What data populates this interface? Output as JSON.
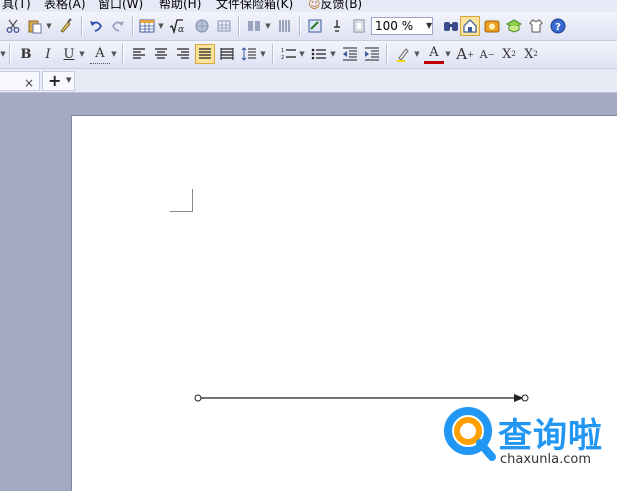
{
  "menubar": {
    "items": [
      "具(T)",
      "表格(A)",
      "窗口(W)",
      "帮助(H)",
      "文件保险箱(K)",
      "反馈(B)"
    ]
  },
  "toolbar_standard": {
    "zoom_value": "100 %",
    "icons": [
      "cut-icon",
      "paste-icon",
      "format-painter-icon",
      "undo-icon",
      "redo-icon",
      "insert-table-icon",
      "formula-icon",
      "hyperlink-icon",
      "table-grid-icon",
      "columns-icon",
      "text-direction-icon",
      "drawing-icon",
      "text-box-icon",
      "page-icon",
      "find-icon",
      "home-icon",
      "gallery-icon",
      "template-icon",
      "skin-icon",
      "help-icon"
    ]
  },
  "toolbar_format": {
    "bold_label": "B",
    "italic_label": "I",
    "underline_label": "U",
    "char_border_label": "A",
    "font_color_label": "A",
    "grow_font_label": "A",
    "shrink_font_label": "A",
    "superscript_label": "X",
    "superscript_mark": "2",
    "subscript_label": "X",
    "subscript_mark": "2"
  },
  "tabs": {
    "close_glyph": "×",
    "new_tab_glyph": "+"
  },
  "watermark": {
    "title": "查询啦",
    "subtitle": "chaxunla.com"
  },
  "colors": {
    "accent": "#2196f3",
    "toolbar_bg": "#e7e9f7",
    "workspace_bg": "#a4aac3"
  }
}
